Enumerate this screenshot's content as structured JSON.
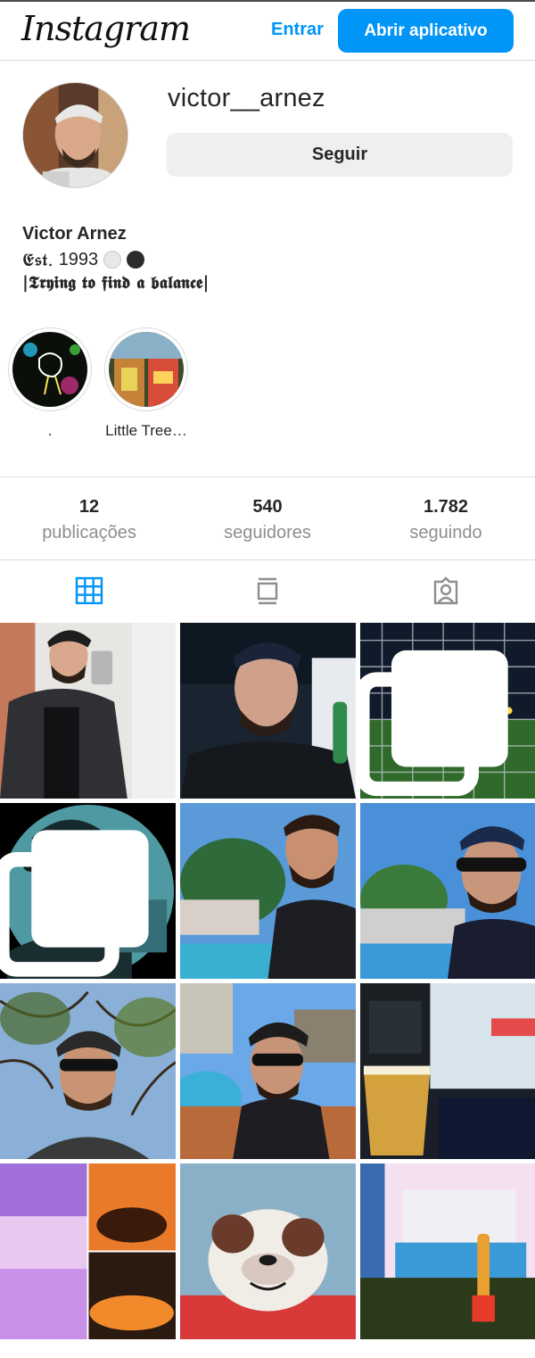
{
  "header": {
    "logo": "Instagram",
    "login": "Entrar",
    "open_app": "Abrir aplicativo"
  },
  "profile": {
    "username": "victor__arnez",
    "follow": "Seguir",
    "full_name": "Victor Arnez",
    "bio_est": "𝕰𝖘𝖙.",
    "bio_year": "1993",
    "bio_line2": "|𝕿𝖗𝖞𝖎𝖓𝖌 𝖙𝖔 𝖋𝖎𝖓𝖉 𝖆 𝖇𝖆𝖑𝖆𝖓𝖈𝖊|"
  },
  "highlights": [
    {
      "label": "."
    },
    {
      "label": "Little Tree…"
    }
  ],
  "stats": [
    {
      "value": "12",
      "label": "publicações"
    },
    {
      "value": "540",
      "label": "seguidores"
    },
    {
      "value": "1.782",
      "label": "seguindo"
    }
  ],
  "tabs": [
    "grid-icon",
    "feed-icon",
    "tagged-icon"
  ],
  "colors": {
    "accent": "#0095f6",
    "border": "#dbdbdb",
    "muted": "#8e8e8e",
    "button_bg": "#efefef"
  }
}
